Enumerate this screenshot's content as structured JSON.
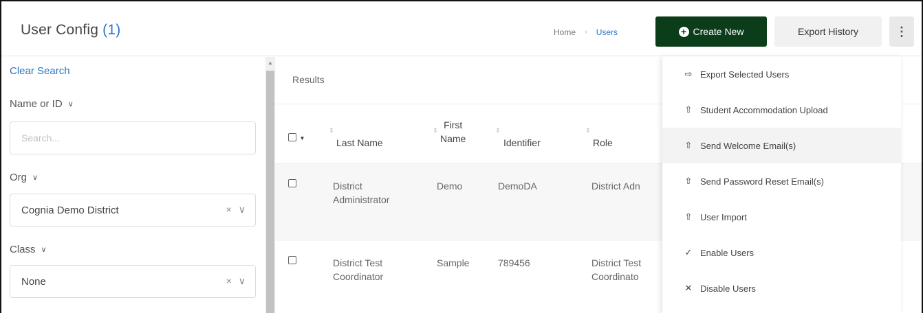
{
  "header": {
    "title": "User Config",
    "count": "(1)",
    "breadcrumb": {
      "home": "Home",
      "separator": "›",
      "current": "Users"
    },
    "create_button": "Create New",
    "export_button": "Export History",
    "kebab": "⋮"
  },
  "sidebar": {
    "clear_search": "Clear Search",
    "filters": [
      {
        "label": "Name or ID",
        "placeholder": "Search...",
        "value": ""
      },
      {
        "label": "Org",
        "value": "Cognia Demo District"
      },
      {
        "label": "Class",
        "value": "None"
      }
    ],
    "clear_glyph": "×",
    "chevron_glyph": "∨"
  },
  "main": {
    "results_label": "Results",
    "columns": [
      {
        "label": "Last Name"
      },
      {
        "label_line1": "First",
        "label_line2": "Name"
      },
      {
        "label": "Identifier"
      },
      {
        "label": "Role"
      }
    ],
    "rows": [
      {
        "last_line1": "District",
        "last_line2": "Administrator",
        "first": "Demo",
        "identifier": "DemoDA",
        "role_line1": "District Adn",
        "role_line2": ""
      },
      {
        "last_line1": "District Test",
        "last_line2": "Coordinator",
        "first": "Sample",
        "identifier": "789456",
        "role_line1": "District Test",
        "role_line2": "Coordinato"
      }
    ]
  },
  "menu": {
    "items": [
      {
        "label": "Export Selected Users",
        "icon": "export-icon",
        "glyph": "⇨"
      },
      {
        "label": "Student Accommodation Upload",
        "icon": "upload-icon",
        "glyph": "⇧"
      },
      {
        "label": "Send Welcome Email(s)",
        "icon": "upload-icon",
        "glyph": "⇧"
      },
      {
        "label": "Send Password Reset Email(s)",
        "icon": "upload-icon",
        "glyph": "⇧"
      },
      {
        "label": "User Import",
        "icon": "upload-icon",
        "glyph": "⇧"
      },
      {
        "label": "Enable Users",
        "icon": "check-icon",
        "glyph": "✓"
      },
      {
        "label": "Disable Users",
        "icon": "close-icon",
        "glyph": "✕"
      }
    ],
    "hovered_index": 2
  },
  "colors": {
    "accent_blue": "#2a74c4",
    "create_button_bg": "#0b3d1a",
    "export_button_bg": "#f1f1f1"
  }
}
